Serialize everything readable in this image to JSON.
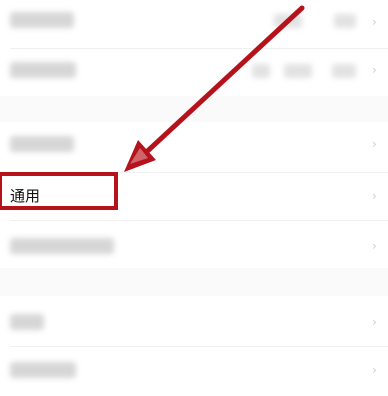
{
  "settings": {
    "rows": [
      {
        "label": "",
        "value": ""
      },
      {
        "label": "",
        "value": ""
      },
      {
        "label": "",
        "value": ""
      },
      {
        "label": "通用",
        "value": ""
      },
      {
        "label": "",
        "value": ""
      },
      {
        "label": "",
        "value": ""
      },
      {
        "label": "",
        "value": ""
      }
    ]
  },
  "annotation": {
    "color": "#b5121b",
    "arrow_direction": "points down-left to the highlighted item"
  }
}
